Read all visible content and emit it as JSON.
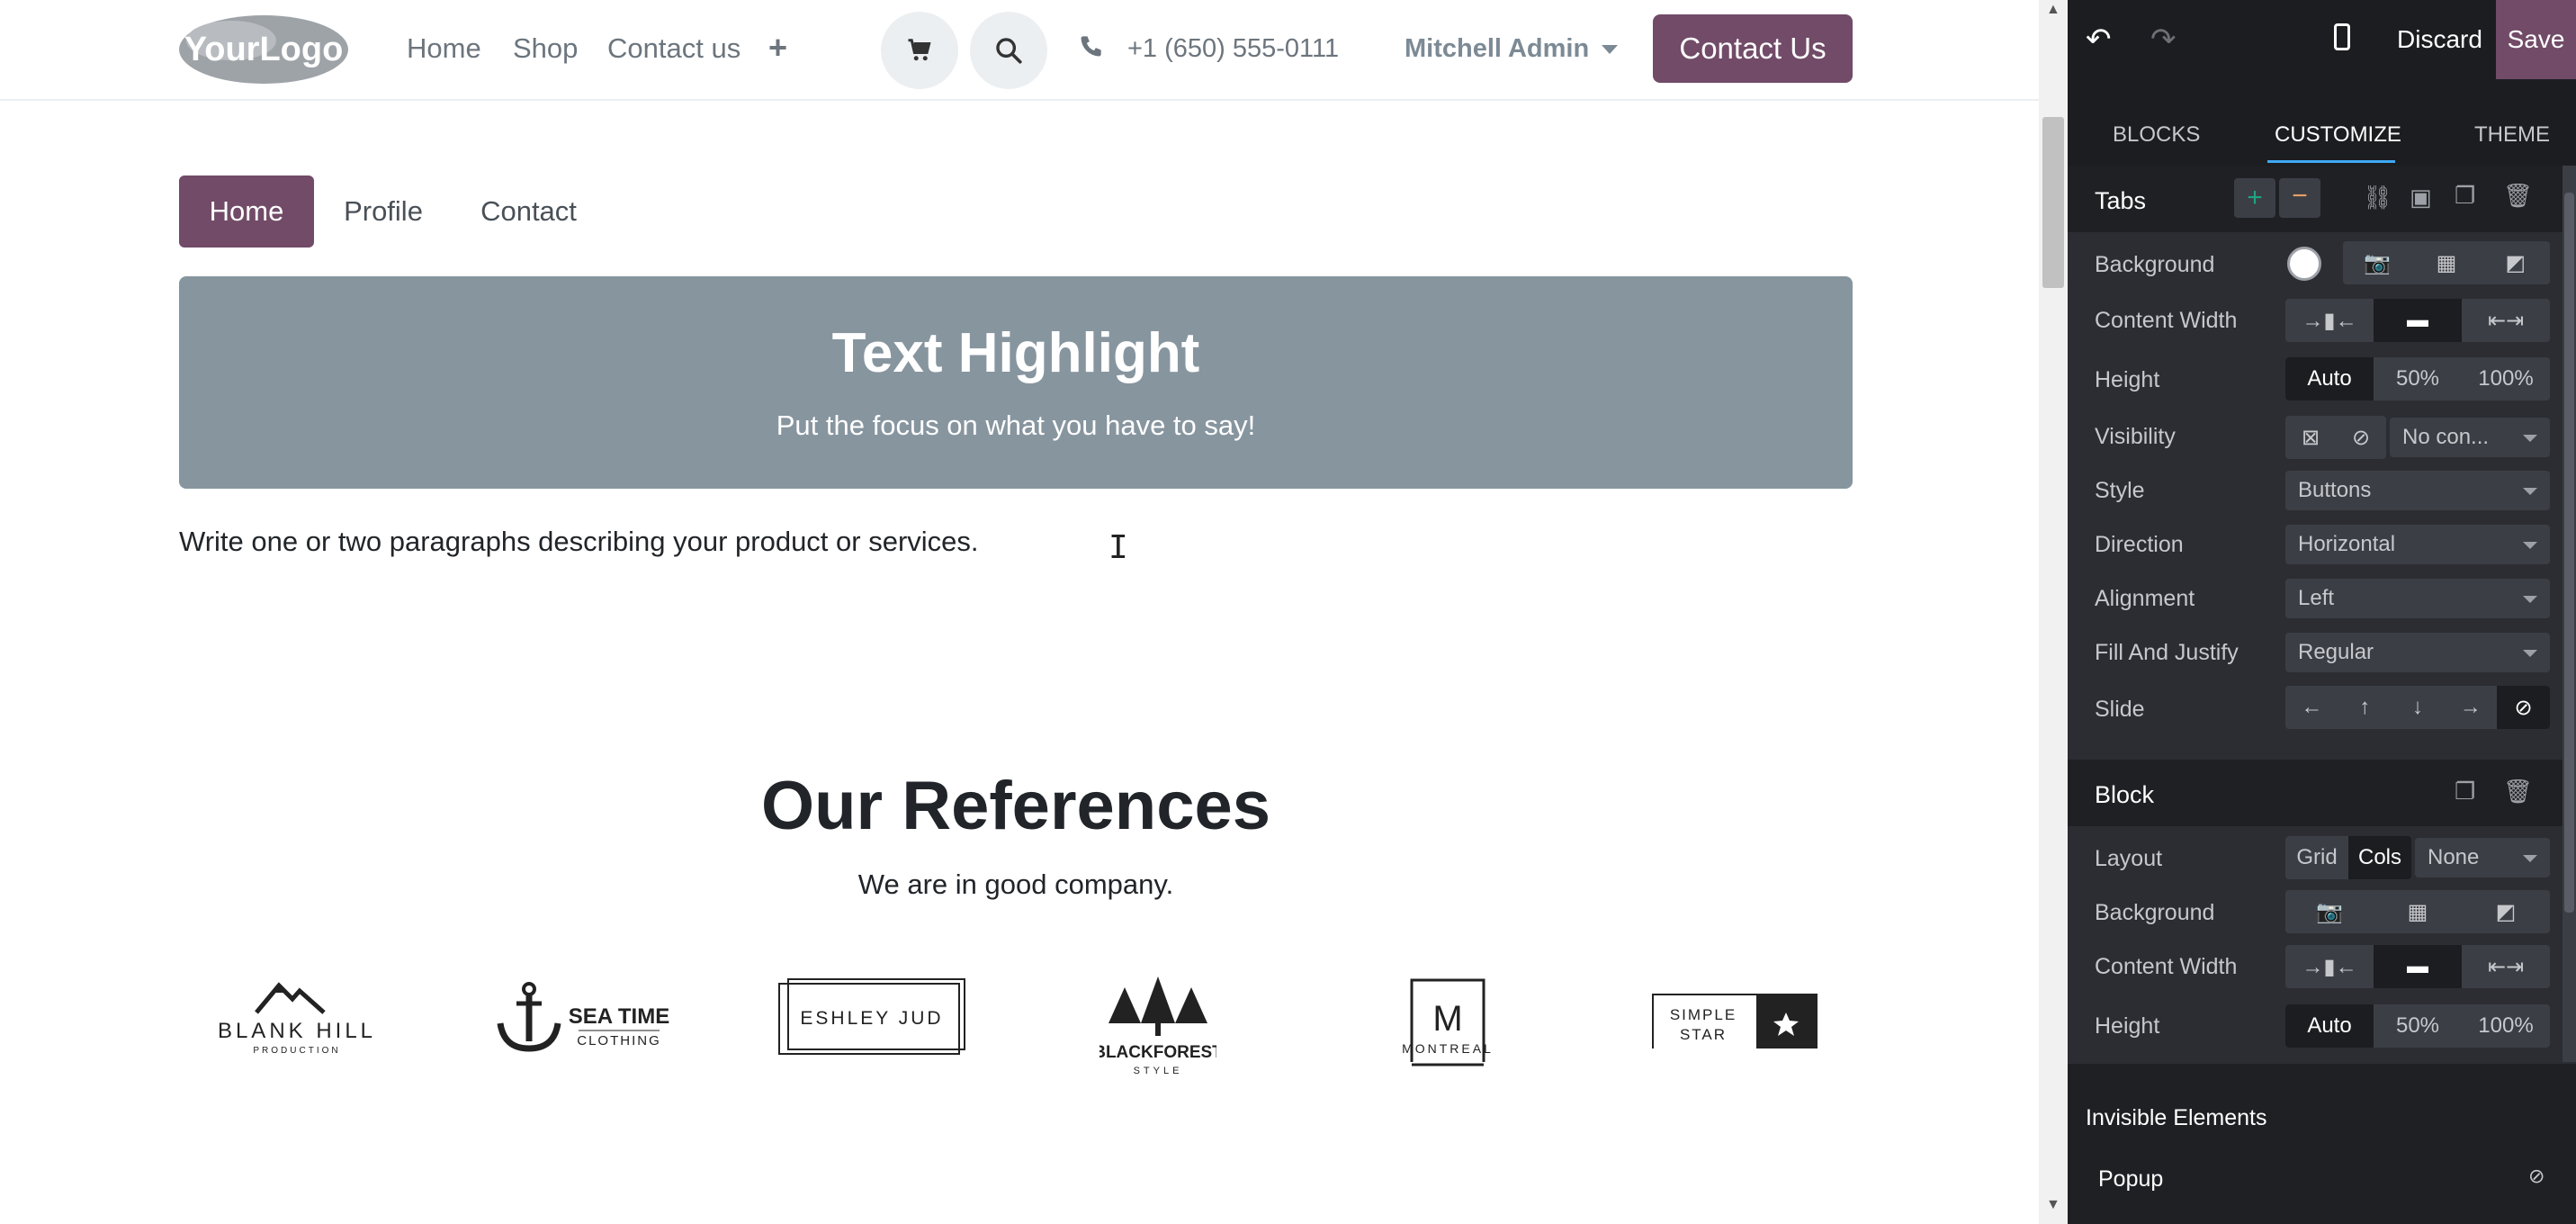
{
  "header": {
    "logo_text": "YourLogo",
    "nav": [
      "Home",
      "Shop",
      "Contact us"
    ],
    "phone": "+1 (650) 555-0111",
    "user": "Mitchell Admin",
    "cta": "Contact Us"
  },
  "tabs_snippet": {
    "tabs": [
      "Home",
      "Profile",
      "Contact"
    ],
    "active": "Home"
  },
  "highlight": {
    "title": "Text Highlight",
    "subtitle": "Put the focus on what you have to say!"
  },
  "paragraph": "Write one or two paragraphs describing your product or services.",
  "references": {
    "title": "Our References",
    "subtitle": "We are in good company.",
    "logos": [
      {
        "name": "blank-hill",
        "line1": "BLANK HILL",
        "line2": "PRODUCTION"
      },
      {
        "name": "sea-time",
        "line1": "SEA TIME",
        "line2": "CLOTHING"
      },
      {
        "name": "eshley-jud",
        "line1": "ESHLEY JUD"
      },
      {
        "name": "blackforest",
        "line1": "BLACKFOREST",
        "line2": "STYLE"
      },
      {
        "name": "montreal",
        "mark": "M",
        "line1": "MONTREAL"
      },
      {
        "name": "simple-star",
        "line1": "SIMPLE",
        "line2": "STAR"
      }
    ]
  },
  "editor": {
    "discard": "Discard",
    "save": "Save",
    "tabs": [
      "BLOCKS",
      "CUSTOMIZE",
      "THEME"
    ],
    "active_tab": "CUSTOMIZE",
    "tabs_section": {
      "title": "Tabs",
      "background_label": "Background",
      "content_width_label": "Content Width",
      "height_label": "Height",
      "height_options": [
        "Auto",
        "50%",
        "100%"
      ],
      "visibility_label": "Visibility",
      "visibility_value": "No con...",
      "style_label": "Style",
      "style_value": "Buttons",
      "direction_label": "Direction",
      "direction_value": "Horizontal",
      "alignment_label": "Alignment",
      "alignment_value": "Left",
      "fill_label": "Fill And Justify",
      "fill_value": "Regular",
      "slide_label": "Slide"
    },
    "block_section": {
      "title": "Block",
      "layout_label": "Layout",
      "layout_options": [
        "Grid",
        "Cols",
        "None"
      ],
      "layout_active": "Cols",
      "background_label": "Background",
      "content_width_label": "Content Width",
      "height_label": "Height",
      "height_options": [
        "Auto",
        "50%",
        "100%"
      ]
    },
    "invisible_title": "Invisible Elements",
    "invisible_items": [
      "Popup"
    ]
  },
  "colors": {
    "brand": "#714b67",
    "highlight_bg": "#87959f",
    "panel_bg": "#2b2d33",
    "accent_underline": "#3fa9f5"
  }
}
